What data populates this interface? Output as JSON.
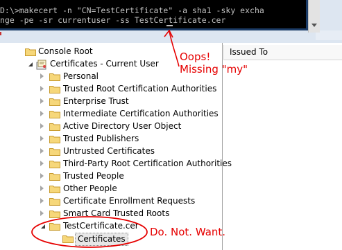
{
  "console": {
    "line1": "D:\\>makecert -n \"CN=TestCertificate\" -a sha1 -sky excha",
    "line2": "nge -pe -sr currentuser -ss TestCertificate.cer"
  },
  "list_view": {
    "column_header": "Issued To"
  },
  "tree": {
    "root": "Console Root",
    "store": "Certificates - Current User",
    "folders": [
      "Personal",
      "Trusted Root Certification Authorities",
      "Enterprise Trust",
      "Intermediate Certification Authorities",
      "Active Directory User Object",
      "Trusted Publishers",
      "Untrusted Certificates",
      "Third-Party Root Certification Authorities",
      "Trusted People",
      "Other People",
      "Certificate Enrollment Requests",
      "Smart Card Trusted Roots"
    ],
    "new_store": "TestCertificate.cer",
    "new_store_child": "Certificates"
  },
  "annotations": {
    "oops_line1": "Oops!",
    "oops_line2": "Missing \"my\"",
    "do_not_want": "Do. Not. Want."
  },
  "colors": {
    "annotation": "#e60000",
    "folder_fill": "#f6d77a",
    "folder_edge": "#c79a2e",
    "console_bg": "#000000",
    "console_text": "#c0c0c0"
  }
}
